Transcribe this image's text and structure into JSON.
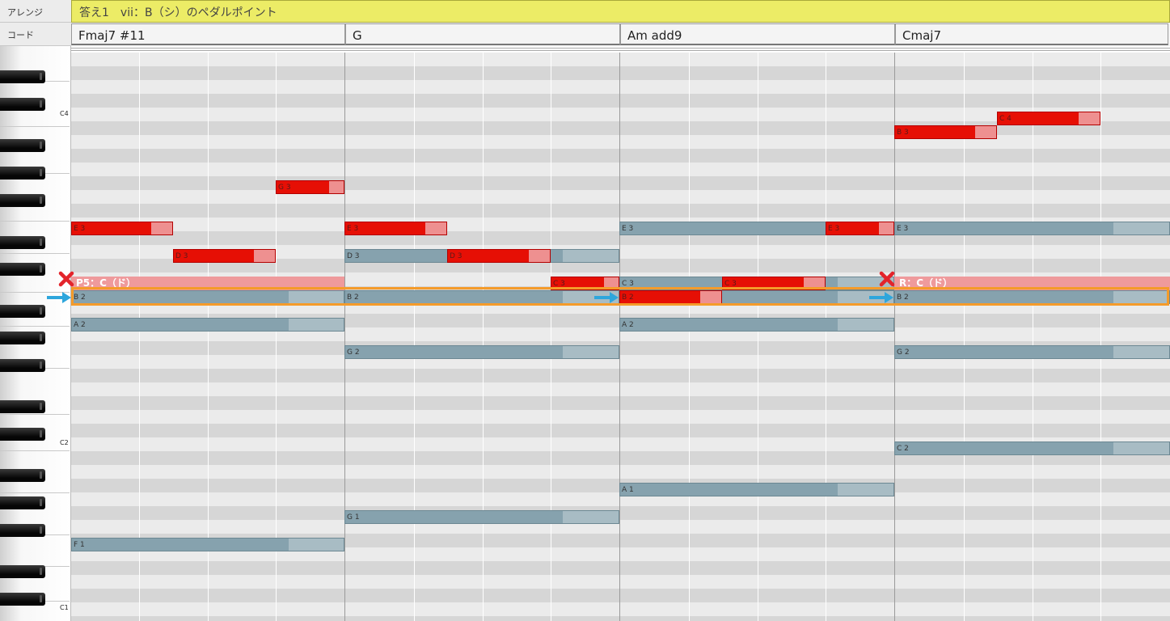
{
  "header": {
    "arrange_label": "アレンジ",
    "chord_label": "コード",
    "arrange_title": "答え1　vii：B（シ）のペダルポイント"
  },
  "chords": [
    "Fmaj7 #11",
    "G",
    "Am add9",
    "Cmaj7"
  ],
  "keyboard": {
    "octave_labels": [
      "C4",
      "C2",
      "C1"
    ]
  },
  "notes": [
    {
      "label": "G 3",
      "color": "red"
    },
    {
      "label": "E 3",
      "color": "red"
    },
    {
      "label": "D 3",
      "color": "red"
    },
    {
      "label": "B 2",
      "color": "gray"
    },
    {
      "label": "A 2",
      "color": "gray"
    },
    {
      "label": "F 1",
      "color": "gray"
    },
    {
      "label": "E 3",
      "color": "red"
    },
    {
      "label": "D 3",
      "color": "gray"
    },
    {
      "label": "D 3",
      "color": "red"
    },
    {
      "label": "C 3",
      "color": "red"
    },
    {
      "label": "B 2",
      "color": "gray"
    },
    {
      "label": "G 2",
      "color": "gray"
    },
    {
      "label": "G 1",
      "color": "gray"
    },
    {
      "label": "E 3",
      "color": "gray"
    },
    {
      "label": "E 3",
      "color": "red"
    },
    {
      "label": "C 3",
      "color": "gray"
    },
    {
      "label": "C 3",
      "color": "red"
    },
    {
      "label": "B 2",
      "color": "red"
    },
    {
      "label": "A 2",
      "color": "gray"
    },
    {
      "label": "A 1",
      "color": "gray"
    },
    {
      "label": "C 4",
      "color": "red"
    },
    {
      "label": "B 3",
      "color": "red"
    },
    {
      "label": "E 3",
      "color": "gray"
    },
    {
      "label": "B 2",
      "color": "gray"
    },
    {
      "label": "G 2",
      "color": "gray"
    },
    {
      "label": "C 2",
      "color": "gray"
    }
  ],
  "annotations": {
    "pedal_1": "P5：C（ド）",
    "pedal_2": "R：C（ド）"
  },
  "colors": {
    "note_active": "#e60f05",
    "note_inactive": "#86a2ae",
    "highlight": "#f49b2a",
    "arrow": "#2ea6dc",
    "cross": "#e3242b",
    "arrange_bar": "#ecec66"
  }
}
